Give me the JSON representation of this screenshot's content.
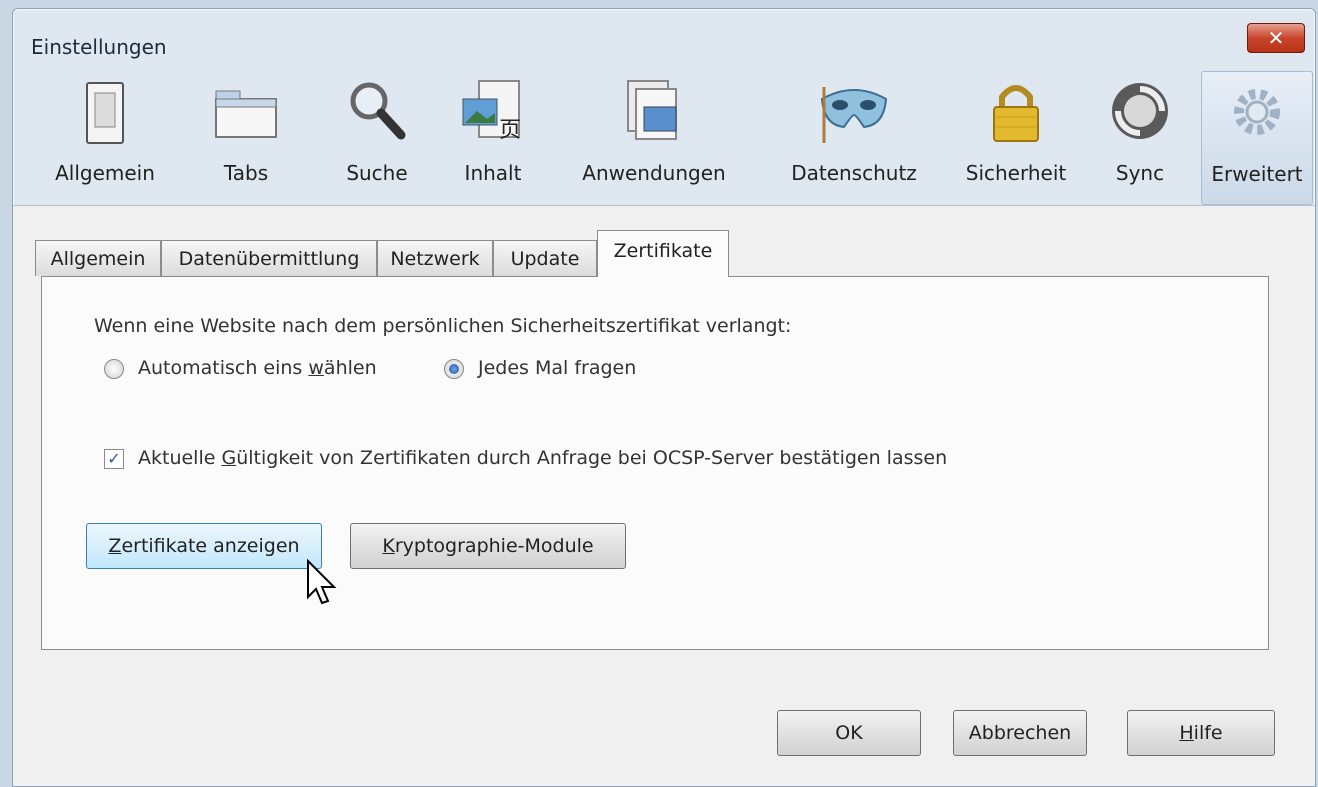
{
  "window": {
    "title": "Einstellungen",
    "close_glyph": "✕"
  },
  "toolbar": {
    "items": [
      {
        "label": "Allgemein",
        "icon": "switch-icon"
      },
      {
        "label": "Tabs",
        "icon": "tabs-window-icon"
      },
      {
        "label": "Suche",
        "icon": "magnifier-icon"
      },
      {
        "label": "Inhalt",
        "icon": "content-icon"
      },
      {
        "label": "Anwendungen",
        "icon": "applications-icon"
      },
      {
        "label": "Datenschutz",
        "icon": "mask-icon"
      },
      {
        "label": "Sicherheit",
        "icon": "padlock-icon"
      },
      {
        "label": "Sync",
        "icon": "sync-icon"
      },
      {
        "label": "Erweitert",
        "icon": "gear-icon",
        "active": true
      }
    ]
  },
  "tabs": [
    {
      "label": "Allgemein"
    },
    {
      "label": "Datenübermittlung"
    },
    {
      "label": "Netzwerk"
    },
    {
      "label": "Update"
    },
    {
      "label": "Zertifikate",
      "selected": true
    }
  ],
  "certificates": {
    "prompt": "Wenn eine Website nach dem persönlichen Sicherheitszertifikat verlangt:",
    "radio_auto": {
      "pre": "Automatisch eins ",
      "ul": "w",
      "post": "ählen",
      "checked": false
    },
    "radio_ask": {
      "pre": "",
      "ul": "J",
      "post": "edes Mal fragen",
      "checked": true
    },
    "ocsp": {
      "pre": "Aktuelle ",
      "ul": "G",
      "post": "ültigkeit von Zertifikaten durch Anfrage bei OCSP-Server bestätigen lassen",
      "checked": true,
      "check_glyph": "✓"
    },
    "show_button": {
      "pre": "",
      "ul": "Z",
      "post": "ertifikate anzeigen"
    },
    "modules_button": {
      "pre": "",
      "ul": "K",
      "post": "ryptographie-Module"
    }
  },
  "footer": {
    "ok": "OK",
    "cancel": "Abbrechen",
    "help": {
      "pre": "",
      "ul": "H",
      "post": "ilfe"
    }
  },
  "colors": {
    "accent": "#3c7fb1",
    "close_red": "#c8452c",
    "window_frame": "#dfe8f1"
  }
}
